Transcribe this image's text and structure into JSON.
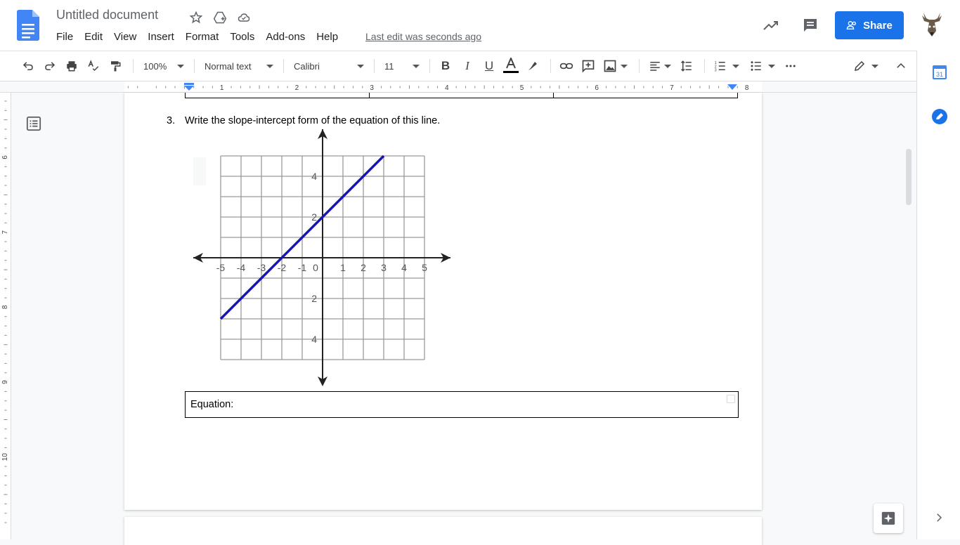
{
  "header": {
    "title": "Untitled document",
    "last_edit": "Last edit was seconds ago",
    "share_label": "Share"
  },
  "menu": [
    "File",
    "Edit",
    "View",
    "Insert",
    "Format",
    "Tools",
    "Add-ons",
    "Help"
  ],
  "toolbar": {
    "zoom": "100%",
    "style": "Normal text",
    "font": "Calibri",
    "size": "11"
  },
  "ruler": {
    "h_labels": [
      "1",
      "2",
      "3",
      "4",
      "5",
      "6",
      "7",
      "8"
    ],
    "v_labels": [
      "6",
      "7",
      "8",
      "9",
      "10"
    ]
  },
  "sidepanel": {
    "calendar_label": "31"
  },
  "doc": {
    "question_number": "3.",
    "question_text": "Write the slope-intercept form of the equation of this line.",
    "answer_label": "Equation:"
  },
  "graph": {
    "x_ticks": [
      "-5",
      "-4",
      "-3",
      "-2",
      "-1",
      "0",
      "1",
      "2",
      "3",
      "4",
      "5"
    ],
    "y_ticks": [
      "4",
      "2",
      "2",
      "4"
    ],
    "line_color": "#1515b8",
    "line_from": [
      -5,
      -3
    ],
    "line_to": [
      3,
      5
    ]
  },
  "colors": {
    "accent": "#1a73e8"
  }
}
